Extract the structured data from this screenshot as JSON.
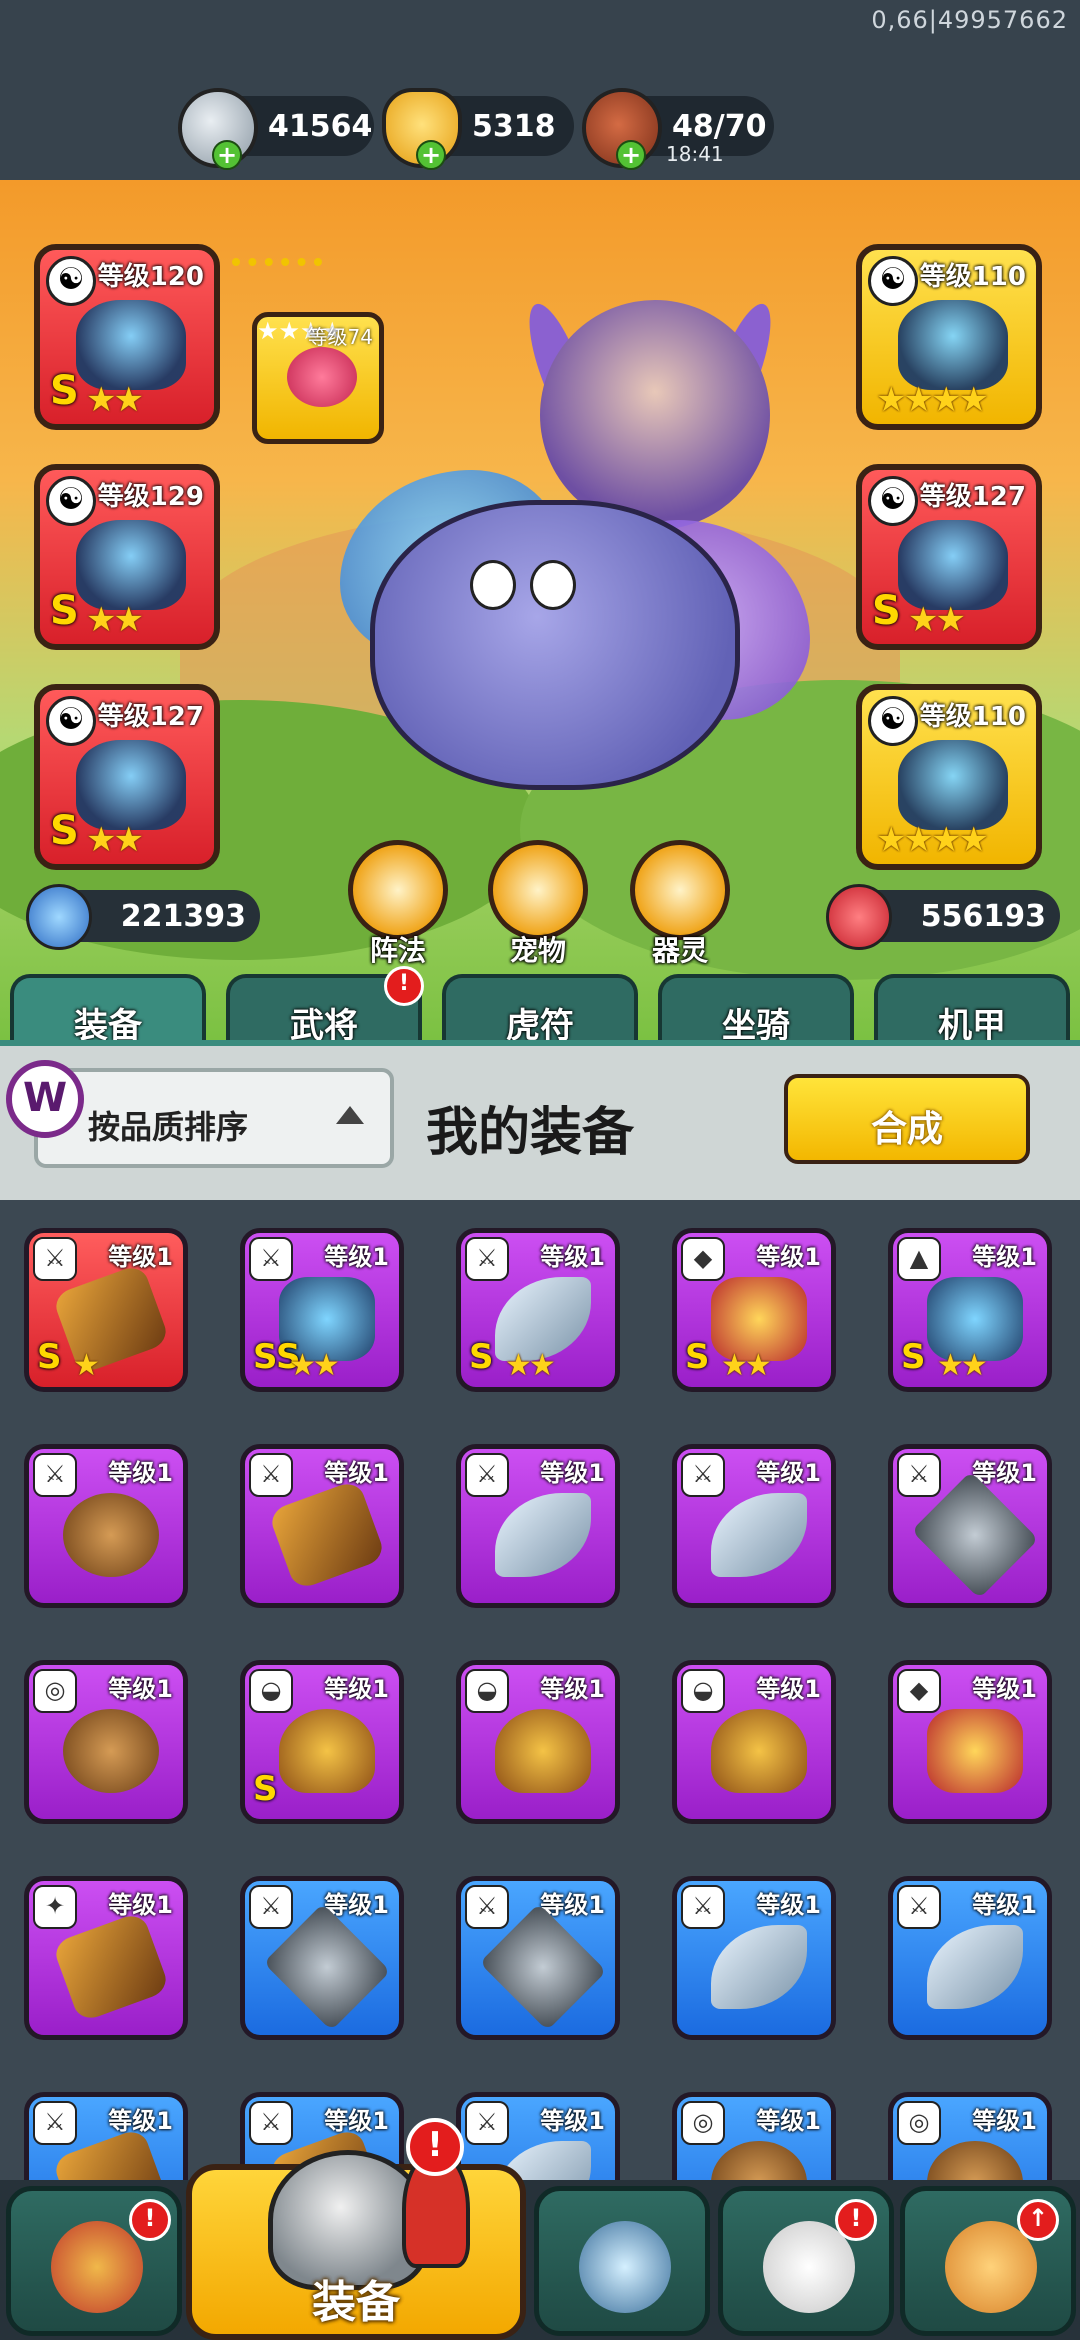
{
  "status": {
    "debug": "0,66|49957662"
  },
  "resources": {
    "silver": "41564",
    "gold": "5318",
    "stamina": "48/70",
    "stamina_timer": "18:41"
  },
  "equipped": {
    "left": [
      {
        "level": "等级120",
        "grade": "S",
        "stars": "★★"
      },
      {
        "level": "等级129",
        "grade": "S",
        "stars": "★★"
      },
      {
        "level": "等级127",
        "grade": "S",
        "stars": "★★"
      }
    ],
    "right": [
      {
        "level": "等级110",
        "grade": "S",
        "stars": "★★★★"
      },
      {
        "level": "等级127",
        "grade": "S",
        "stars": "★★"
      },
      {
        "level": "等级110",
        "grade": "S",
        "stars": "★★★★"
      }
    ],
    "pet_slot": {
      "level": "等级74",
      "stars": "★★★★"
    }
  },
  "stats": {
    "attack": "221393",
    "hp": "556193"
  },
  "round_buttons": {
    "formation": "阵法",
    "pet": "宠物",
    "spirit": "器灵"
  },
  "tabs": [
    "装备",
    "武将",
    "虎符",
    "坐骑",
    "机甲"
  ],
  "tab_badge": "!",
  "header": {
    "sort_label": "按品质排序",
    "title": "我的装备",
    "synth": "合成",
    "w_icon": "W"
  },
  "inventory": {
    "level": "等级1",
    "rows": [
      [
        {
          "color": "red",
          "grade": "S",
          "stars": "★",
          "kind": "weapon",
          "badge": "⚔"
        },
        {
          "color": "purple",
          "grade": "SS",
          "stars": "★★",
          "kind": "hero",
          "badge": "⚔"
        },
        {
          "color": "purple",
          "grade": "S",
          "stars": "★★",
          "kind": "blade",
          "badge": "⚔"
        },
        {
          "color": "purple",
          "grade": "S",
          "stars": "★★",
          "kind": "armor",
          "badge": "◆"
        },
        {
          "color": "purple",
          "grade": "S",
          "stars": "★★",
          "kind": "hero",
          "badge": "▲"
        }
      ],
      [
        {
          "color": "purple",
          "kind": "bow",
          "badge": "⚔"
        },
        {
          "color": "purple",
          "kind": "weapon",
          "badge": "⚔"
        },
        {
          "color": "purple",
          "kind": "blade",
          "badge": "⚔"
        },
        {
          "color": "purple",
          "kind": "blade",
          "badge": "⚔"
        },
        {
          "color": "purple",
          "kind": "star",
          "badge": "⚔"
        }
      ],
      [
        {
          "color": "purple",
          "kind": "bow",
          "badge": "◎"
        },
        {
          "color": "purple",
          "grade": "S",
          "kind": "helm",
          "badge": "◒"
        },
        {
          "color": "purple",
          "kind": "helm",
          "badge": "◒"
        },
        {
          "color": "purple",
          "kind": "helm",
          "badge": "◒"
        },
        {
          "color": "purple",
          "kind": "armor",
          "badge": "◆"
        }
      ],
      [
        {
          "color": "purple",
          "kind": "weapon",
          "badge": "✦"
        },
        {
          "color": "blue",
          "kind": "star",
          "badge": "⚔"
        },
        {
          "color": "blue",
          "kind": "star",
          "badge": "⚔"
        },
        {
          "color": "blue",
          "kind": "blade",
          "badge": "⚔"
        },
        {
          "color": "blue",
          "kind": "blade",
          "badge": "⚔"
        }
      ],
      [
        {
          "color": "blue",
          "kind": "weapon",
          "badge": "⚔"
        },
        {
          "color": "blue",
          "kind": "weapon",
          "badge": "⚔"
        },
        {
          "color": "blue",
          "kind": "blade",
          "badge": "⚔"
        },
        {
          "color": "blue",
          "kind": "bow",
          "badge": "◎"
        },
        {
          "color": "blue",
          "kind": "bow",
          "badge": "◎"
        }
      ]
    ]
  },
  "bottom_nav": {
    "main_label": "装备",
    "alert": "!",
    "icons": [
      "gate-icon",
      "helmet-icon",
      "crossed-swords-icon",
      "scroll-icon",
      "fist-icon"
    ]
  },
  "colors": {
    "red": "#d8202a",
    "purple": "#9a1fc9",
    "blue": "#1b6be0",
    "gold": "#f3b700",
    "tab": "#2f6b62"
  }
}
